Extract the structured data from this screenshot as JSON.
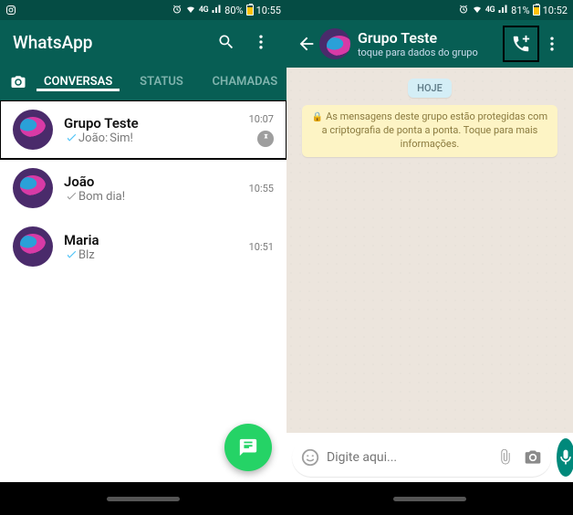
{
  "left": {
    "status": {
      "battery_pct": "80%",
      "time": "10:55",
      "net": "4G"
    },
    "title": "WhatsApp",
    "tabs": {
      "conversas": "CONVERSAS",
      "status": "STATUS",
      "chamadas": "CHAMADAS"
    },
    "chats": [
      {
        "name": "Grupo Teste",
        "preview_prefix": "João: ",
        "preview": "Sim!",
        "time": "10:07",
        "ticks": "read",
        "pinned": true
      },
      {
        "name": "João",
        "preview_prefix": "",
        "preview": "Bom dia!",
        "time": "10:55",
        "ticks": "sent",
        "pinned": false
      },
      {
        "name": "Maria",
        "preview_prefix": "",
        "preview": "Blz",
        "time": "10:51",
        "ticks": "read",
        "pinned": false
      }
    ]
  },
  "right": {
    "status": {
      "battery_pct": "81%",
      "time": "10:52",
      "net": "4G"
    },
    "group_name": "Grupo Teste",
    "group_sub": "toque para dados do grupo",
    "date_chip": "HOJE",
    "encryption_msg": "As mensagens deste grupo estão protegidas com a criptografia de ponta a ponta. Toque para mais informações.",
    "composer_placeholder": "Digite aqui..."
  }
}
